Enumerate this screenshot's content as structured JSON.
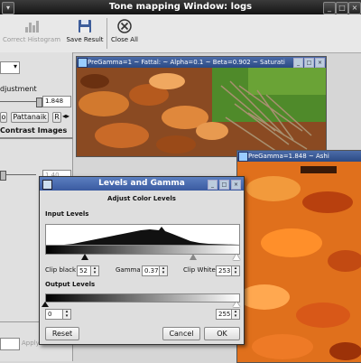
{
  "window": {
    "title": "Tone mapping Window: logs"
  },
  "toolbar": {
    "correct_histogram": "Correct Histogram",
    "save_result": "Save Result",
    "close_all": "Close All"
  },
  "left_panel": {
    "adjustment_label": "djustment",
    "pregamma_value": "1.848",
    "pattanaik_tab": "Pattanaik",
    "tab_left_fragment": "o",
    "tab_right_fragment": "R",
    "contrast_images": "Contrast Images",
    "slider_value_fragment": "1.40",
    "apply_label": "Apply"
  },
  "image_window_1": {
    "title": "PreGamma=1 ~ Fattal: ~ Alpha=0.1 ~ Beta=0.902 ~ Saturati"
  },
  "image_window_2": {
    "title": "PreGamma=1.848 ~ Ashi"
  },
  "dialog": {
    "title": "Levels and Gamma",
    "subtitle": "Adjust Color Levels",
    "input_levels": "Input Levels",
    "clip_black_label": "Clip black",
    "clip_black_value": "52",
    "gamma_label": "Gamma",
    "gamma_value": "0.37",
    "clip_white_label": "Clip White",
    "clip_white_value": "253",
    "output_levels": "Output Levels",
    "output_black_value": "0",
    "output_white_value": "255",
    "reset": "Reset",
    "cancel": "Cancel",
    "ok": "OK"
  },
  "colors": {
    "titlebar": "#1c1c1c",
    "dialog_title": "#4a6cb0",
    "window_title": "#3a5a96",
    "wood_orange": "#e0701c",
    "grass_green": "#4f8a2a"
  }
}
